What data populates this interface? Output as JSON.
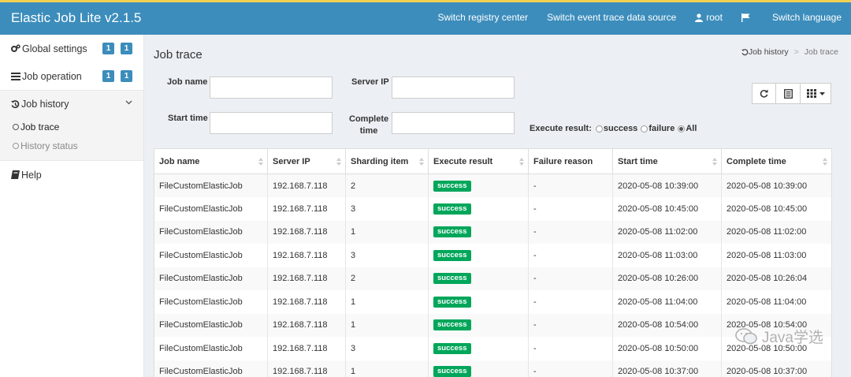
{
  "app": {
    "title": "Elastic Job Lite v2.1.5"
  },
  "topnav": {
    "registry": "Switch registry center",
    "event_trace": "Switch event trace data source",
    "user": "root",
    "language": "Switch language"
  },
  "sidebar": {
    "global_settings": {
      "label": "Global settings",
      "badges": [
        "1",
        "1"
      ]
    },
    "job_operation": {
      "label": "Job operation",
      "badges": [
        "1",
        "1"
      ]
    },
    "job_history": {
      "label": "Job history"
    },
    "job_trace": {
      "label": "Job trace"
    },
    "history_status": {
      "label": "History status"
    },
    "help": {
      "label": "Help"
    }
  },
  "page": {
    "title": "Job trace",
    "breadcrumb": {
      "parent": "Job history",
      "current": "Job trace"
    }
  },
  "filters": {
    "job_name": {
      "label": "Job name",
      "value": ""
    },
    "server_ip": {
      "label": "Server IP",
      "value": ""
    },
    "start_time": {
      "label": "Start time",
      "value": ""
    },
    "complete_time": {
      "label_line1": "Complete",
      "label_line2": "time",
      "value": ""
    },
    "execute_result": {
      "label": "Execute result:",
      "options": [
        "success",
        "failure",
        "All"
      ],
      "selected": "All"
    }
  },
  "colors": {
    "header": "#3c8dbc",
    "success": "#00a65a",
    "accent_bar": "#f0d050"
  },
  "table": {
    "columns": [
      "Job name",
      "Server IP",
      "Sharding item",
      "Execute result",
      "Failure reason",
      "Start time",
      "Complete time"
    ],
    "rows": [
      [
        "FileCustomElasticJob",
        "192.168.7.118",
        "2",
        "success",
        "-",
        "2020-05-08 10:39:00",
        "2020-05-08 10:39:00"
      ],
      [
        "FileCustomElasticJob",
        "192.168.7.118",
        "3",
        "success",
        "-",
        "2020-05-08 10:45:00",
        "2020-05-08 10:45:00"
      ],
      [
        "FileCustomElasticJob",
        "192.168.7.118",
        "1",
        "success",
        "-",
        "2020-05-08 11:02:00",
        "2020-05-08 11:02:00"
      ],
      [
        "FileCustomElasticJob",
        "192.168.7.118",
        "3",
        "success",
        "-",
        "2020-05-08 11:03:00",
        "2020-05-08 11:03:00"
      ],
      [
        "FileCustomElasticJob",
        "192.168.7.118",
        "2",
        "success",
        "-",
        "2020-05-08 10:26:00",
        "2020-05-08 10:26:04"
      ],
      [
        "FileCustomElasticJob",
        "192.168.7.118",
        "1",
        "success",
        "-",
        "2020-05-08 11:04:00",
        "2020-05-08 11:04:00"
      ],
      [
        "FileCustomElasticJob",
        "192.168.7.118",
        "1",
        "success",
        "-",
        "2020-05-08 10:54:00",
        "2020-05-08 10:54:00"
      ],
      [
        "FileCustomElasticJob",
        "192.168.7.118",
        "3",
        "success",
        "-",
        "2020-05-08 10:50:00",
        "2020-05-08 10:50:00"
      ],
      [
        "FileCustomElasticJob",
        "192.168.7.118",
        "1",
        "success",
        "-",
        "2020-05-08 10:37:00",
        "2020-05-08 10:37:00"
      ]
    ]
  },
  "watermark": {
    "text": "Java学选"
  }
}
